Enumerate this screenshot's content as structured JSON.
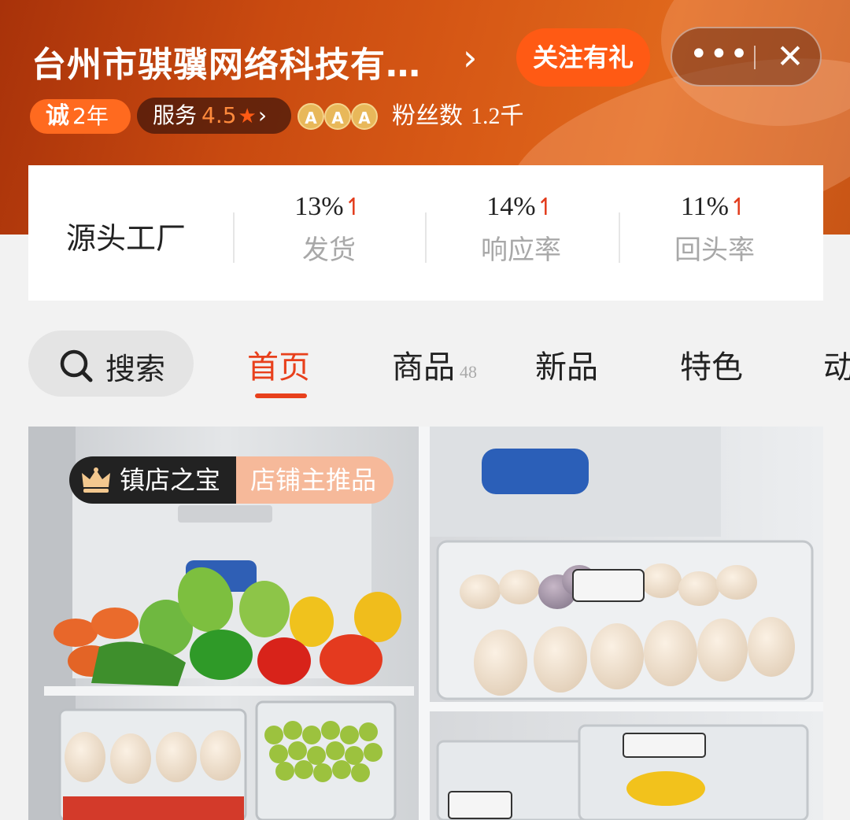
{
  "header": {
    "shop_name": "台州市骐骥网络科技有…",
    "follow_label": "关注有礼",
    "more_glyph": "•••",
    "close_glyph": "✕",
    "chevron_glyph": "›"
  },
  "badges": {
    "cheng_char": "诚",
    "cheng_years": "2年",
    "service_label": "服务",
    "service_rating": "4.5",
    "level_letters": [
      "A",
      "A",
      "A"
    ],
    "fans_label": "粉丝数",
    "fans_count": "1.2千"
  },
  "stats": {
    "factory_label": "源头工厂",
    "items": [
      {
        "value": "13%",
        "label": "发货"
      },
      {
        "value": "14%",
        "label": "响应率"
      },
      {
        "value": "11%",
        "label": "回头率"
      }
    ],
    "up_glyph": "↿"
  },
  "nav": {
    "search_label": "搜索",
    "tabs": [
      {
        "label": "首页",
        "count": ""
      },
      {
        "label": "商品",
        "count": "48"
      },
      {
        "label": "新品",
        "count": ""
      },
      {
        "label": "特色",
        "count": ""
      },
      {
        "label": "动",
        "count": ""
      }
    ],
    "active_tab": "首页"
  },
  "product": {
    "badge_left": "镇店之宝",
    "badge_right": "店铺主推品"
  },
  "colors": {
    "accent": "#e8401c",
    "follow_bg": "#ff5a14",
    "header_orange": "#d85a16"
  }
}
